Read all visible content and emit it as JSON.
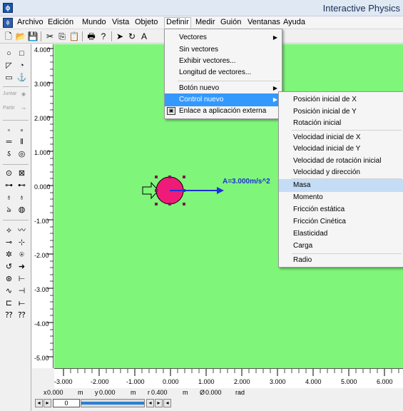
{
  "window": {
    "title": "Interactive Physics"
  },
  "menubar": {
    "items": [
      {
        "label": "Archivo"
      },
      {
        "label": "Edición"
      },
      {
        "label": "Mundo"
      },
      {
        "label": "Vista"
      },
      {
        "label": "Objeto"
      },
      {
        "label": "Definir"
      },
      {
        "label": "Medir"
      },
      {
        "label": "Guión"
      },
      {
        "label": "Ventanas"
      },
      {
        "label": "Ayuda"
      }
    ],
    "open": "Definir"
  },
  "define_menu": {
    "items": [
      {
        "label": "Vectores",
        "submenu": true
      },
      {
        "label": "Sin vectores"
      },
      {
        "label": "Exhibir vectores..."
      },
      {
        "label": "Longitud de vectores..."
      },
      {
        "label": "Botón nuevo",
        "submenu": true
      },
      {
        "label": "Control nuevo",
        "submenu": true,
        "highlighted": true
      },
      {
        "label": "Enlace a aplicación externa"
      }
    ]
  },
  "control_submenu": {
    "items": [
      {
        "label": "Posición inicial de X"
      },
      {
        "label": "Posición inicial de Y"
      },
      {
        "label": "Rotación inicial"
      },
      {
        "label": "Velocidad inicial de X"
      },
      {
        "label": "Velocidad inicial de Y"
      },
      {
        "label": "Velocidad de rotación inicial"
      },
      {
        "label": "Velocidad y dirección"
      },
      {
        "label": "Masa",
        "highlighted": true
      },
      {
        "label": "Momento"
      },
      {
        "label": "Fricción estática"
      },
      {
        "label": "Fricción Cinética"
      },
      {
        "label": "Elasticidad"
      },
      {
        "label": "Carga"
      },
      {
        "label": "Radio"
      }
    ]
  },
  "palette": {
    "join_label": "Juntar",
    "split_label": "Partir"
  },
  "vertical_ruler": {
    "labels": [
      "4.000",
      "3.000",
      "2.000",
      "1.000",
      "0.000",
      "-1.00",
      "-2.00",
      "-3.00",
      "-4.00",
      "-5.00"
    ]
  },
  "horizontal_ruler": {
    "labels": [
      "-3.000",
      "-2.000",
      "-1.000",
      "0.000",
      "1.000",
      "2.000",
      "3.000",
      "4.000",
      "5.000",
      "6.000"
    ]
  },
  "workspace": {
    "background": "#7ff57a",
    "body_color": "#ee1c78",
    "vector_color": "#1f2fd6",
    "acceleration_label": "A=3.000m/s^2"
  },
  "readout": {
    "x_label": "x",
    "x_value": "0.000",
    "x_unit": "m",
    "y_label": "y",
    "y_value": "0.000",
    "y_unit": "m",
    "r_label": "r",
    "r_value": "0.400",
    "r_unit": "m",
    "phi_label": "Ø",
    "phi_value": "0.000",
    "phi_unit": "rad"
  },
  "tape": {
    "frame_value": "0"
  }
}
